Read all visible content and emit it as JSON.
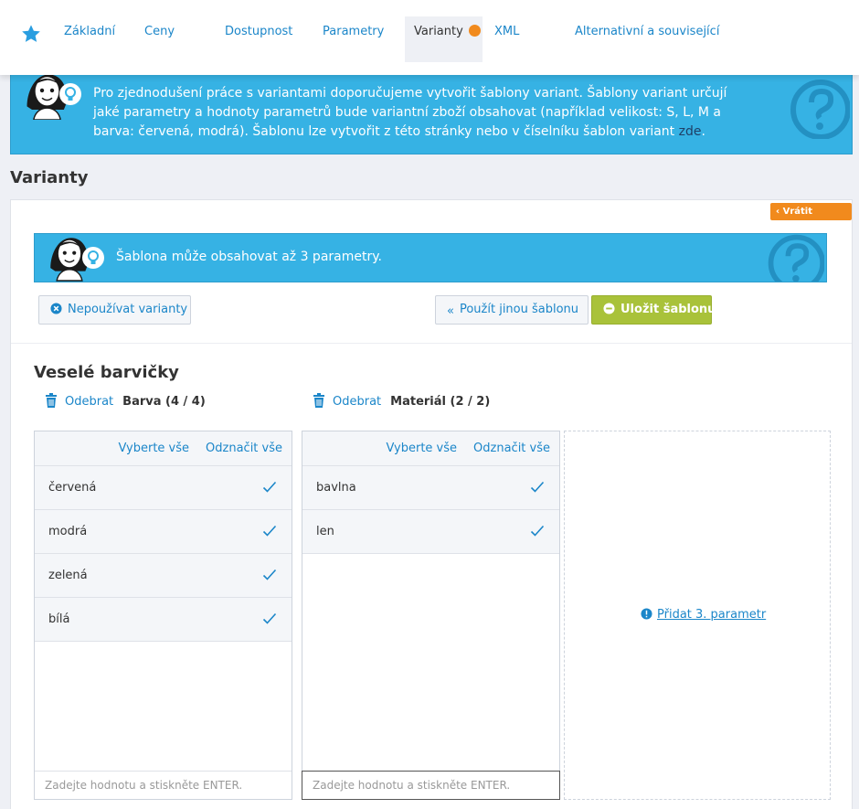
{
  "tabs": [
    {
      "label": "Základní"
    },
    {
      "label": "Ceny"
    },
    {
      "label": "Dostupnost"
    },
    {
      "label": "Parametry"
    },
    {
      "label": "Varianty"
    },
    {
      "label": "XML"
    },
    {
      "label": "Alternativní a související"
    }
  ],
  "banner": {
    "text": "Pro zjednodušení práce s variantami doporučujeme vytvořit šablony variant. Šablony variant určují jaké parametry a hodnoty parametrů bude variantní zboží obsahovat (například velikost: S, L, M a barva: červená, modrá). Šablonu lze vytvořit z této stránky nebo v číselníku šablon variant ",
    "link": "zde",
    "end": "."
  },
  "section_title": "Varianty",
  "revert_label": "‹ Vrátit změnu",
  "inner_banner": "Šablona může obsahovat až 3 parametry.",
  "buttons": {
    "no_variants": "Nepoužívat varianty",
    "other_template": "Použít jinou šablonu",
    "save_template": "Uložit šablonu"
  },
  "template_name": "Veselé barvičky",
  "params": [
    {
      "remove_label": "Odebrat",
      "name": "Barva (4 / 4)",
      "select_all": "Vyberte vše",
      "deselect_all": "Odznačit vše",
      "values": [
        "červená",
        "modrá",
        "zelená",
        "bílá"
      ],
      "placeholder": "Zadejte hodnotu a stiskněte ENTER."
    },
    {
      "remove_label": "Odebrat",
      "name": "Materiál (2 / 2)",
      "select_all": "Vyberte vše",
      "deselect_all": "Odznačit vše",
      "values": [
        "bavlna",
        "len"
      ],
      "placeholder": "Zadejte hodnotu a stiskněte ENTER."
    }
  ],
  "add_param": "Přidat 3. parametr",
  "colors": {
    "accent": "#1b86c9",
    "banner": "#36b2e4",
    "orange": "#f18a1d",
    "green": "#a9c23a"
  }
}
